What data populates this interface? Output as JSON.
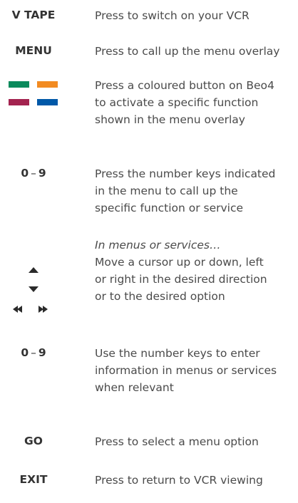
{
  "rows": {
    "vtape": {
      "key": "V TAPE",
      "desc": [
        "Press to switch on your VCR"
      ]
    },
    "menu": {
      "key": "MENU",
      "desc": [
        "Press to call up the menu overlay"
      ]
    },
    "colour": {
      "desc": [
        "Press a coloured button on Beo4",
        "to activate a specific function",
        "shown in the menu overlay"
      ],
      "colors": {
        "green": "#0a8a5c",
        "orange": "#f28b22",
        "red": "#a3234f",
        "blue": "#0058a8"
      }
    },
    "numbers1": {
      "key_from": "0",
      "key_sep": "–",
      "key_to": "9",
      "desc": [
        "Press the number keys indicated",
        "in the menu to call up the",
        "specific function or service"
      ]
    },
    "arrows": {
      "heading": "In menus or services…",
      "desc": [
        "Move a cursor up or down, left",
        "or right in the desired direction",
        "or to the desired option"
      ],
      "icons": [
        "arrow-up-icon",
        "arrow-down-icon",
        "arrow-left-icon",
        "arrow-right-icon"
      ]
    },
    "numbers2": {
      "key_from": "0",
      "key_sep": "–",
      "key_to": "9",
      "desc": [
        "Use the number keys to enter",
        "information in menus or services",
        "when relevant"
      ]
    },
    "go": {
      "key": "GO",
      "desc": [
        "Press to select a menu option"
      ]
    },
    "exit": {
      "key": "EXIT",
      "desc": [
        "Press to return to VCR viewing"
      ]
    }
  }
}
